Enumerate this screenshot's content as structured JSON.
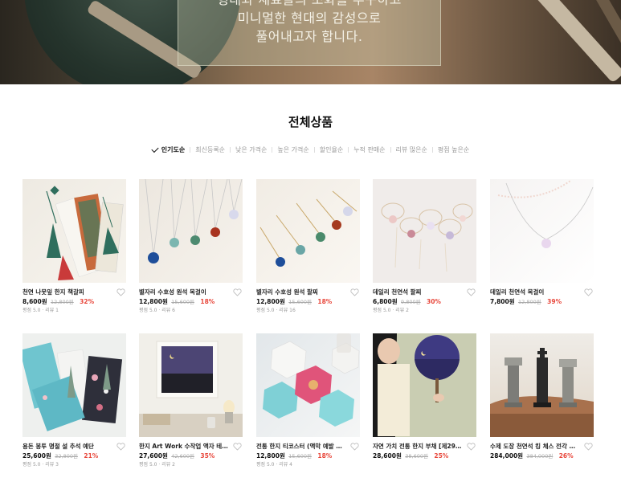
{
  "hero": {
    "lines": [
      "형태와 재료들의 조화를 추구하고",
      "미니멀한 현대의 감성으로",
      "풀어내고자 합니다."
    ]
  },
  "section": {
    "title": "전체상품"
  },
  "sort": {
    "options": [
      "인기도순",
      "최신등록순",
      "낮은 가격순",
      "높은 가격순",
      "할인율순",
      "누적 판매순",
      "리뷰 많은순",
      "평점 높은순"
    ],
    "active": "인기도순"
  },
  "products": [
    {
      "name": "천연 나뭇잎 한지 책갈피",
      "price": "8,600원",
      "original_price": "12,800원",
      "discount": "32%",
      "meta": "평점 5.0 · 리뷰 1",
      "image": "bookmark-tassels"
    },
    {
      "name": "별자리 수호성 원석 목걸이",
      "price": "12,800원",
      "original_price": "15,600원",
      "discount": "18%",
      "meta": "평점 5.0 · 리뷰 6",
      "image": "gemstone-necklaces"
    },
    {
      "name": "별자리 수호성 원석 팔찌",
      "price": "12,800원",
      "original_price": "15,600원",
      "discount": "18%",
      "meta": "평점 5.0 · 리뷰 16",
      "image": "gemstone-bracelets"
    },
    {
      "name": "데일리 천연석 팔찌",
      "price": "6,800원",
      "original_price": "9,800원",
      "discount": "30%",
      "meta": "평점 5.0 · 리뷰 2",
      "image": "daily-bracelets"
    },
    {
      "name": "데일리 천연석 목걸이",
      "price": "7,800원",
      "original_price": "12,800원",
      "discount": "39%",
      "meta": "",
      "image": "daily-necklace"
    },
    {
      "name": "용돈 봉투 명절 설 추석 예단",
      "price": "25,600원",
      "original_price": "32,800원",
      "discount": "21%",
      "meta": "평점 5.0 · 리뷰 3",
      "image": "money-envelopes"
    },
    {
      "name": "한지 Art Work 수작업 액자 테이블 …",
      "price": "27,600원",
      "original_price": "42,600원",
      "discount": "35%",
      "meta": "평점 5.0 · 리뷰 2",
      "image": "art-frame"
    },
    {
      "name": "전통 한지 티코스터 (액막 예발 포…",
      "price": "12,800원",
      "original_price": "15,600원",
      "discount": "18%",
      "meta": "평점 5.0 · 리뷰 4",
      "image": "tea-coasters"
    },
    {
      "name": "자연 가치 전통 한지 부채 [제29회 …",
      "price": "28,600원",
      "original_price": "38,600원",
      "discount": "25%",
      "meta": "",
      "image": "hanji-fan"
    },
    {
      "name": "수제 도장 천연석 킹 체스 전각 고…",
      "price": "284,000원",
      "original_price": "384,000원",
      "discount": "26%",
      "meta": "",
      "image": "chess-seals"
    }
  ],
  "colors": {
    "accent": "#e8473b",
    "text": "#222222",
    "muted": "#999999"
  },
  "icons": {
    "wishlist": "heart-outline-icon",
    "active_sort": "checkmark-icon"
  }
}
